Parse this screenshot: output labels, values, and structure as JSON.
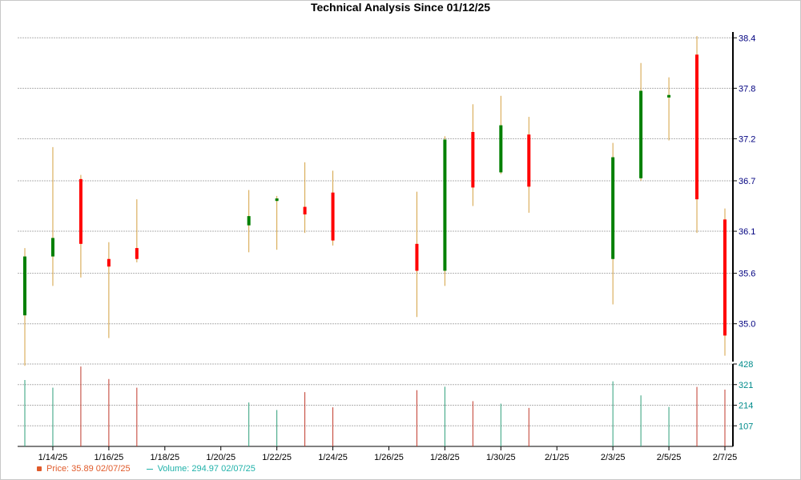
{
  "chart_data": {
    "type": "candlestick",
    "title": "Technical Analysis Since 01/12/25",
    "colors": {
      "up": "#008000",
      "down": "#ff0000",
      "wick": "#d4a040",
      "volume_up": "#2e9f7a",
      "volume_down": "#c0392b",
      "price_axis_text": "#000080",
      "volume_axis_text": "#008b8b",
      "grid": "#b0b0b0",
      "legend_price": "#e05a2a",
      "legend_volume": "#20b2aa"
    },
    "x_start": "2025-01-13",
    "x_end": "2025-02-07",
    "x_tick_labels": [
      "1/14/25",
      "1/16/25",
      "1/18/25",
      "1/20/25",
      "1/22/25",
      "1/24/25",
      "1/26/25",
      "1/28/25",
      "1/30/25",
      "2/1/25",
      "2/3/25",
      "2/5/25",
      "2/7/25"
    ],
    "price_axis": {
      "ylim": [
        34.55,
        38.45
      ],
      "ticks": [
        35.0,
        35.6,
        36.1,
        36.7,
        37.2,
        37.8,
        38.4
      ],
      "tick_labels": [
        "35.0",
        "35.6",
        "36.1",
        "36.7",
        "37.2",
        "37.8",
        "38.4"
      ],
      "grid": true
    },
    "volume_axis": {
      "ylim": [
        0,
        428
      ],
      "ticks": [
        107,
        214,
        321,
        428
      ],
      "tick_labels": [
        "107",
        "214",
        "321",
        "428"
      ],
      "grid": true
    },
    "candles": [
      {
        "date": "2025-01-13",
        "open": 35.1,
        "high": 35.9,
        "low": 34.5,
        "close": 35.8,
        "volume": 345
      },
      {
        "date": "2025-01-14",
        "open": 35.8,
        "high": 37.1,
        "low": 35.45,
        "close": 36.02,
        "volume": 305
      },
      {
        "date": "2025-01-15",
        "open": 36.72,
        "high": 36.77,
        "low": 35.55,
        "close": 35.95,
        "volume": 415
      },
      {
        "date": "2025-01-16",
        "open": 35.77,
        "high": 35.97,
        "low": 34.83,
        "close": 35.68,
        "volume": 350
      },
      {
        "date": "2025-01-17",
        "open": 35.9,
        "high": 36.48,
        "low": 35.73,
        "close": 35.77,
        "volume": 305
      },
      {
        "date": "2025-01-21",
        "open": 36.17,
        "high": 36.59,
        "low": 35.85,
        "close": 36.28,
        "volume": 228
      },
      {
        "date": "2025-01-22",
        "open": 36.46,
        "high": 36.52,
        "low": 35.88,
        "close": 36.49,
        "volume": 189
      },
      {
        "date": "2025-01-23",
        "open": 36.39,
        "high": 36.92,
        "low": 36.08,
        "close": 36.3,
        "volume": 282
      },
      {
        "date": "2025-01-24",
        "open": 36.56,
        "high": 36.82,
        "low": 35.93,
        "close": 35.99,
        "volume": 203
      },
      {
        "date": "2025-01-27",
        "open": 35.95,
        "high": 36.57,
        "low": 35.08,
        "close": 35.63,
        "volume": 292
      },
      {
        "date": "2025-01-28",
        "open": 35.63,
        "high": 37.23,
        "low": 35.45,
        "close": 37.19,
        "volume": 310
      },
      {
        "date": "2025-01-29",
        "open": 37.28,
        "high": 37.61,
        "low": 36.4,
        "close": 36.62,
        "volume": 235
      },
      {
        "date": "2025-01-30",
        "open": 36.8,
        "high": 37.71,
        "low": 36.78,
        "close": 37.36,
        "volume": 222
      },
      {
        "date": "2025-01-31",
        "open": 37.25,
        "high": 37.46,
        "low": 36.32,
        "close": 36.63,
        "volume": 200
      },
      {
        "date": "2025-02-03",
        "open": 35.77,
        "high": 37.15,
        "low": 35.23,
        "close": 36.98,
        "volume": 338
      },
      {
        "date": "2025-02-04",
        "open": 36.73,
        "high": 38.1,
        "low": 36.7,
        "close": 37.77,
        "volume": 265
      },
      {
        "date": "2025-02-05",
        "open": 37.69,
        "high": 37.93,
        "low": 37.18,
        "close": 37.72,
        "volume": 205
      },
      {
        "date": "2025-02-06",
        "open": 38.2,
        "high": 38.42,
        "low": 36.08,
        "close": 36.48,
        "volume": 309
      },
      {
        "date": "2025-02-07",
        "open": 36.24,
        "high": 36.37,
        "low": 34.62,
        "close": 34.86,
        "volume": 295
      }
    ],
    "legend": {
      "price_text": "Price: 35.89  02/07/25",
      "volume_text": "Volume: 294.97  02/07/25"
    }
  }
}
